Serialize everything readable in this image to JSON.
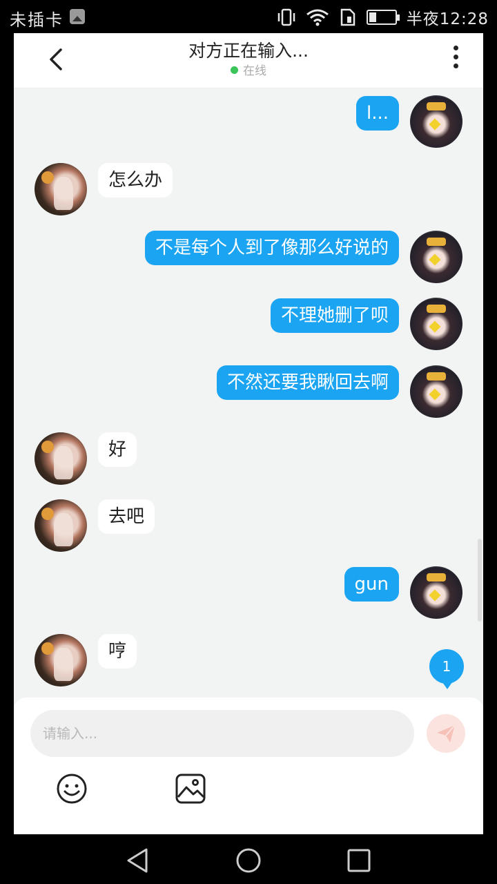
{
  "status": {
    "carrier": "未插卡",
    "time": "半夜12:28"
  },
  "header": {
    "title": "对方正在输入...",
    "online_label": "在线"
  },
  "messages": [
    {
      "side": "out",
      "text": "l..."
    },
    {
      "side": "in",
      "text": "怎么办"
    },
    {
      "side": "out",
      "text": "不是每个人到了像那么好说的"
    },
    {
      "side": "out",
      "text": "不理她删了呗"
    },
    {
      "side": "out",
      "text": "不然还要我瞅回去啊"
    },
    {
      "side": "in",
      "text": "好"
    },
    {
      "side": "in",
      "text": "去吧"
    },
    {
      "side": "out",
      "text": "gun"
    },
    {
      "side": "in",
      "text": "哼"
    }
  ],
  "unread_count": "1",
  "composer": {
    "placeholder": "请输入..."
  },
  "icons": {
    "back": "chevron-left-icon",
    "more": "more-vertical-icon",
    "send": "send-icon",
    "emoji": "emoji-icon",
    "image": "image-icon"
  },
  "colors": {
    "accent": "#1aa4f2",
    "online": "#3ac45a",
    "background": "#f2f4f3"
  }
}
